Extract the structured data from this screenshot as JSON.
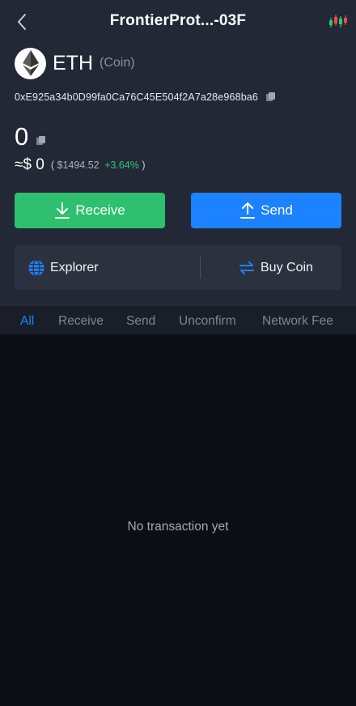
{
  "header": {
    "title": "FrontierProt...-03F",
    "back_icon": "chevron-left-icon",
    "chart_icon": "candlestick-chart-icon"
  },
  "coin": {
    "symbol": "ETH",
    "type": "(Coin)",
    "address": "0xE925a34b0D99fa0Ca76C45E504f2A7a28e968ba6"
  },
  "balance": {
    "amount": "0",
    "fiat": "≈$ 0",
    "detail_open": "(",
    "price": "$1494.52",
    "change": "+3.64%",
    "detail_close": ")"
  },
  "actions": {
    "receive_label": "Receive",
    "send_label": "Send"
  },
  "tools": {
    "explorer_label": "Explorer",
    "buy_label": "Buy Coin"
  },
  "tabs": [
    {
      "label": "All",
      "active": true
    },
    {
      "label": "Receive",
      "active": false
    },
    {
      "label": "Send",
      "active": false
    },
    {
      "label": "Unconfirm",
      "active": false
    },
    {
      "label": "Network Fee",
      "active": false
    }
  ],
  "empty_message": "No transaction yet",
  "colors": {
    "receive": "#2ec06e",
    "send": "#1c82ff",
    "positive": "#2ec774",
    "active_tab": "#1c82ff"
  }
}
